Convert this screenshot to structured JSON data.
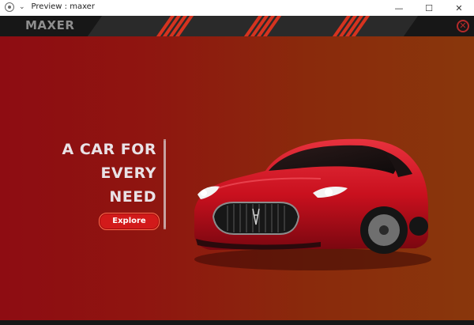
{
  "window": {
    "title": "Preview : maxer",
    "controls": {
      "minimize": "—",
      "maximize": "☐",
      "close": "✕"
    }
  },
  "header": {
    "logo": "MAXER",
    "close_symbol": "✕"
  },
  "hero": {
    "headline_lines": [
      "A CAR FOR",
      "EVERY",
      "NEED"
    ],
    "explore_label": "Explore"
  },
  "colors": {
    "header_bg": "#171717",
    "accent_stripes": "#d6331f",
    "hero_gradient_start": "#8e0c12",
    "hero_gradient_end": "#89370c",
    "button": "#d21a1a"
  }
}
